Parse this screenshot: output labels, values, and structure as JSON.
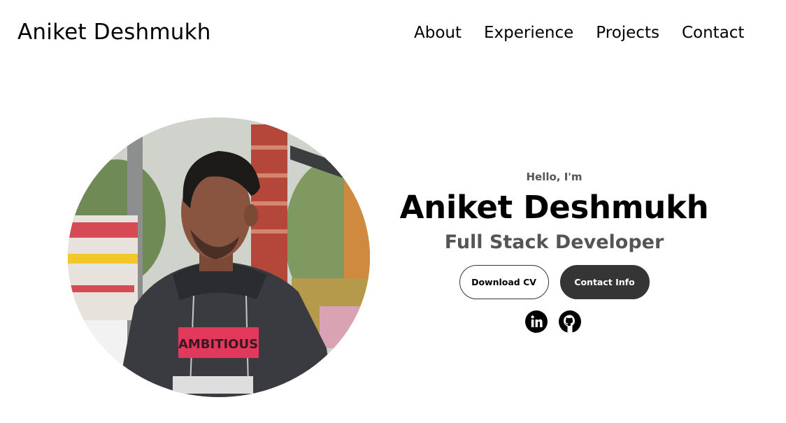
{
  "nav": {
    "logo": "Aniket Deshmukh",
    "links": [
      {
        "label": "About"
      },
      {
        "label": "Experience"
      },
      {
        "label": "Projects"
      },
      {
        "label": "Contact"
      }
    ]
  },
  "hero": {
    "photo_alt": "Aniket Deshmukh profile picture",
    "hoodie_print": "AMBITIOUS",
    "greeting": "Hello, I'm",
    "name": "Aniket Deshmukh",
    "title": "Full Stack Developer",
    "buttons": {
      "download_cv": "Download CV",
      "contact_info": "Contact Info"
    },
    "social": [
      {
        "icon": "linkedin-icon"
      },
      {
        "icon": "github-icon"
      }
    ]
  },
  "colors": {
    "text_primary": "#000000",
    "text_secondary": "#555555",
    "button_dark": "#353535",
    "background": "#ffffff"
  }
}
